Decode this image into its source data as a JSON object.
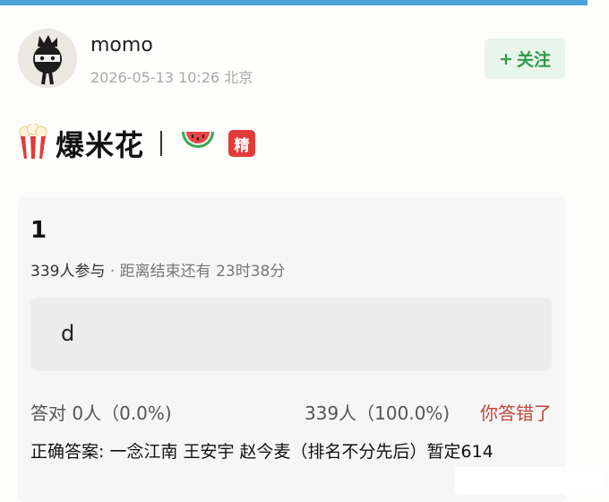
{
  "post": {
    "author": {
      "name": "momo",
      "date": "2026-05-13 10:26",
      "location": "北京"
    },
    "follow_button": {
      "plus": "+",
      "label": "关注"
    },
    "title": {
      "text": "爆米花",
      "icons": [
        "popcorn-icon",
        "watermelon-icon"
      ],
      "badge": "精"
    }
  },
  "poll": {
    "title": "1",
    "participants": "339人参与",
    "separator": "·",
    "countdown": "距离结束还有 23时38分",
    "option": {
      "label": "d"
    },
    "correct_label": "答对",
    "correct_stat": "0人（0.0%)",
    "option_stat": "339人（100.0%)",
    "result": "你答错了",
    "answer_label": "正确答案:",
    "answer_text": "一念江南 王安宇 赵今麦（排名不分先后）暂定614"
  },
  "colors": {
    "accent_bar": "#4aa3d8",
    "follow_green": "#2f9a4a",
    "follow_bg": "#e8f5ea",
    "badge_red": "#e23b3b",
    "wrong_red": "#c0473a"
  }
}
